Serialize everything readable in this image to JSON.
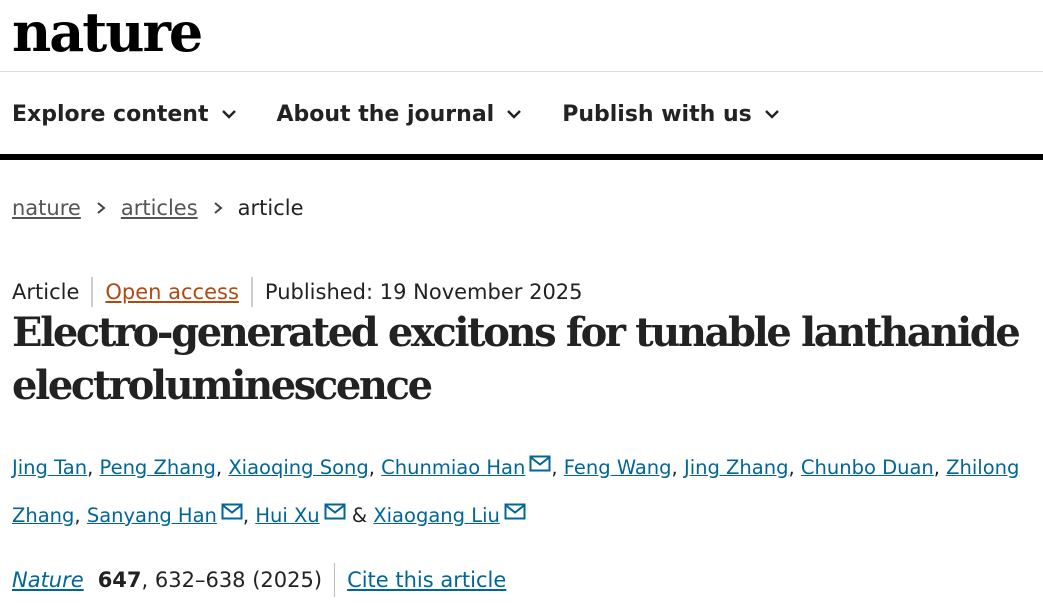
{
  "site": {
    "logo": "nature"
  },
  "nav": {
    "items": [
      {
        "label": "Explore content"
      },
      {
        "label": "About the journal"
      },
      {
        "label": "Publish with us"
      }
    ]
  },
  "breadcrumb": {
    "items": [
      "nature",
      "articles"
    ],
    "current": "article"
  },
  "meta": {
    "type": "Article",
    "access": "Open access",
    "published": "Published: 19 November 2025"
  },
  "article": {
    "title": "Electro-generated excitons for tunable lanthanide electroluminescence"
  },
  "authors": [
    {
      "name": "Jing Tan",
      "corresponding": false,
      "sep": ", "
    },
    {
      "name": "Peng Zhang",
      "corresponding": false,
      "sep": ", "
    },
    {
      "name": "Xiaoqing Song",
      "corresponding": false,
      "sep": ", "
    },
    {
      "name": "Chunmiao Han",
      "corresponding": true,
      "sep": ", "
    },
    {
      "name": "Feng Wang",
      "corresponding": false,
      "sep": ", "
    },
    {
      "name": "Jing Zhang",
      "corresponding": false,
      "sep": ", "
    },
    {
      "name": "Chunbo Duan",
      "corresponding": false,
      "sep": ", "
    },
    {
      "name": "Zhilong Zhang",
      "corresponding": false,
      "sep": ", "
    },
    {
      "name": "Sanyang Han",
      "corresponding": true,
      "sep": ", "
    },
    {
      "name": "Hui Xu",
      "corresponding": true,
      "sep": " & "
    },
    {
      "name": "Xiaogang Liu",
      "corresponding": true,
      "sep": ""
    }
  ],
  "citation": {
    "journal": "Nature",
    "volume": "647",
    "pages": ", 632–638 (2025)",
    "cite_label": "Cite this article"
  },
  "colors": {
    "link": "#006699",
    "open_access": "#b04a12",
    "text": "#222222"
  },
  "icons": {
    "nav_dropdown": "chevron-down-icon",
    "breadcrumb_separator": "chevron-right-icon",
    "corresponding_author": "mail-icon"
  }
}
